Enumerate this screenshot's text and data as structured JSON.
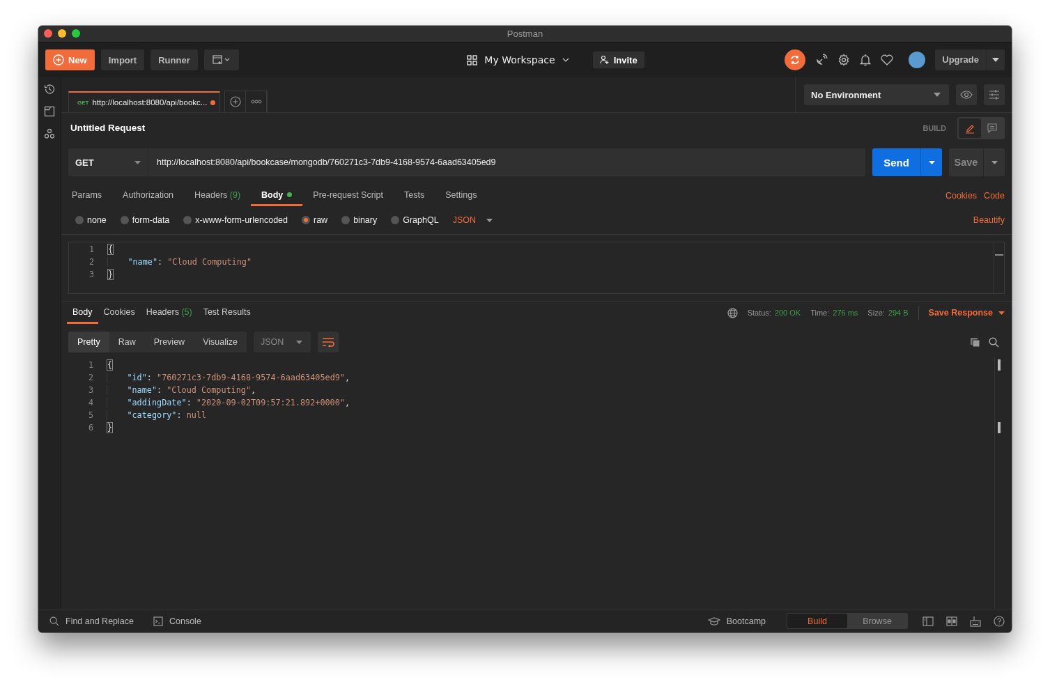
{
  "window": {
    "title": "Postman"
  },
  "toolbar": {
    "new": "New",
    "import": "Import",
    "runner": "Runner",
    "workspace": "My Workspace",
    "invite": "Invite",
    "upgrade": "Upgrade"
  },
  "open_tabs": [
    {
      "method": "GET",
      "label": "http://localhost:8080/api/bookc...",
      "unsaved": true,
      "selected": true
    }
  ],
  "environment": {
    "value": "No Environment"
  },
  "request": {
    "title": "Untitled Request",
    "mode": "BUILD",
    "method": "GET",
    "url": "http://localhost:8080/api/bookcase/mongodb/760271c3-7db9-4168-9574-6aad63405ed9",
    "send": "Send",
    "save": "Save"
  },
  "request_tabs": [
    {
      "label": "Params",
      "selected": false
    },
    {
      "label": "Authorization",
      "selected": false
    },
    {
      "label": "Headers",
      "count": "(9)",
      "selected": false
    },
    {
      "label": "Body",
      "dot": true,
      "selected": true
    },
    {
      "label": "Pre-request Script",
      "selected": false
    },
    {
      "label": "Tests",
      "selected": false
    },
    {
      "label": "Settings",
      "selected": false
    }
  ],
  "request_links": [
    "Cookies",
    "Code"
  ],
  "body_types": [
    {
      "label": "none",
      "selected": false
    },
    {
      "label": "form-data",
      "selected": false
    },
    {
      "label": "x-www-form-urlencoded",
      "selected": false
    },
    {
      "label": "raw",
      "selected": true
    },
    {
      "label": "binary",
      "selected": false
    },
    {
      "label": "GraphQL",
      "selected": false
    }
  ],
  "body_format": "JSON",
  "beautify": "Beautify",
  "request_body": [
    {
      "number": "1",
      "tokens": [
        {
          "kind": "brace",
          "text": "{"
        }
      ]
    },
    {
      "number": "2",
      "tokens": [
        {
          "kind": "key",
          "text": "    \"name\""
        },
        {
          "kind": "punct",
          "text": ": "
        },
        {
          "kind": "str",
          "text": "\"Cloud Computing\""
        }
      ]
    },
    {
      "number": "3",
      "tokens": [
        {
          "kind": "brace",
          "text": "}"
        }
      ]
    }
  ],
  "response_tabs": [
    {
      "label": "Body",
      "selected": true
    },
    {
      "label": "Cookies",
      "selected": false
    },
    {
      "label": "Headers",
      "count": "(5)",
      "selected": false
    },
    {
      "label": "Test Results",
      "selected": false
    }
  ],
  "response_status": [
    {
      "label": "Status:",
      "value": "200 OK"
    },
    {
      "label": "Time:",
      "value": "276 ms"
    },
    {
      "label": "Size:",
      "value": "294 B"
    }
  ],
  "save_response": "Save Response",
  "view_modes": [
    {
      "label": "Pretty",
      "selected": true
    },
    {
      "label": "Raw",
      "selected": false
    },
    {
      "label": "Preview",
      "selected": false
    },
    {
      "label": "Visualize",
      "selected": false
    }
  ],
  "response_format": "JSON",
  "response_body": [
    {
      "number": "1",
      "tokens": [
        {
          "kind": "brace",
          "text": "{"
        }
      ]
    },
    {
      "number": "2",
      "tokens": [
        {
          "kind": "key",
          "text": "    \"id\""
        },
        {
          "kind": "punct",
          "text": ": "
        },
        {
          "kind": "str",
          "text": "\"760271c3-7db9-4168-9574-6aad63405ed9\""
        },
        {
          "kind": "punct",
          "text": ","
        }
      ]
    },
    {
      "number": "3",
      "tokens": [
        {
          "kind": "key",
          "text": "    \"name\""
        },
        {
          "kind": "punct",
          "text": ": "
        },
        {
          "kind": "str",
          "text": "\"Cloud Computing\""
        },
        {
          "kind": "punct",
          "text": ","
        }
      ]
    },
    {
      "number": "4",
      "tokens": [
        {
          "kind": "key",
          "text": "    \"addingDate\""
        },
        {
          "kind": "punct",
          "text": ": "
        },
        {
          "kind": "str",
          "text": "\"2020-09-02T09:57:21.892+0000\""
        },
        {
          "kind": "punct",
          "text": ","
        }
      ]
    },
    {
      "number": "5",
      "tokens": [
        {
          "kind": "key",
          "text": "    \"category\""
        },
        {
          "kind": "punct",
          "text": ": "
        },
        {
          "kind": "null",
          "text": "null"
        }
      ]
    },
    {
      "number": "6",
      "tokens": [
        {
          "kind": "brace",
          "text": "}"
        }
      ]
    }
  ],
  "footer": {
    "find": "Find and Replace",
    "console": "Console",
    "bootcamp": "Bootcamp",
    "modes": [
      {
        "label": "Build",
        "selected": true
      },
      {
        "label": "Browse",
        "selected": false
      }
    ]
  }
}
